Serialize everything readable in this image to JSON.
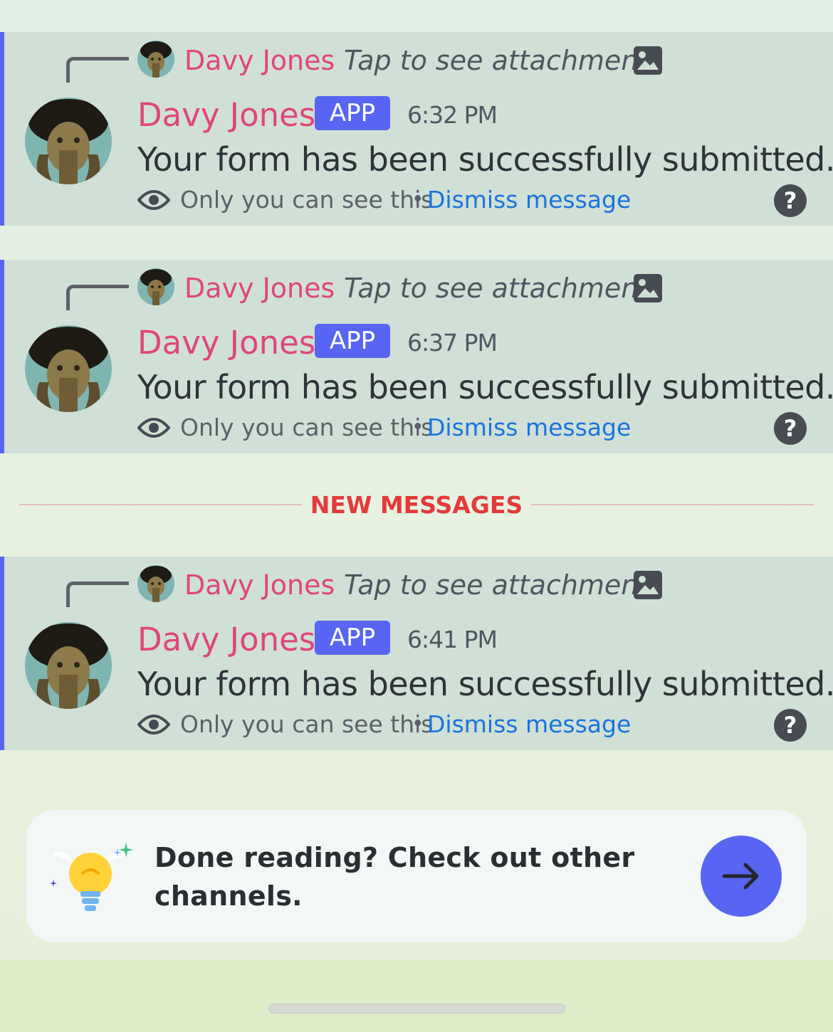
{
  "messages": [
    {
      "reply_author": "Davy Jones",
      "reply_text": "Tap to see attachment",
      "author": "Davy Jones",
      "tag": "APP",
      "time": "6:32 PM",
      "text": "Your form has been successfully submitted.",
      "visibility_note": "Only you can see this",
      "separator": "•",
      "dismiss_label": "Dismiss message",
      "help_label": "?"
    },
    {
      "reply_author": "Davy Jones",
      "reply_text": "Tap to see attachment",
      "author": "Davy Jones",
      "tag": "APP",
      "time": "6:37 PM",
      "text": "Your form has been successfully submitted.",
      "visibility_note": "Only you can see this",
      "separator": "•",
      "dismiss_label": "Dismiss message",
      "help_label": "?"
    },
    {
      "reply_author": "Davy Jones",
      "reply_text": "Tap to see attachment",
      "author": "Davy Jones",
      "tag": "APP",
      "time": "6:41 PM",
      "text": "Your form has been successfully submitted.",
      "visibility_note": "Only you can see this",
      "separator": "•",
      "dismiss_label": "Dismiss message",
      "help_label": "?"
    }
  ],
  "new_messages_label": "NEW MESSAGES",
  "prompt": {
    "text": "Done reading? Check out other channels.",
    "icon": "lightbulb-icon",
    "button_icon": "arrow-right-icon"
  },
  "colors": {
    "accent": "#5865f2",
    "author": "#e0457b",
    "link": "#1a73e0",
    "new_messages": "#e33a3a"
  }
}
